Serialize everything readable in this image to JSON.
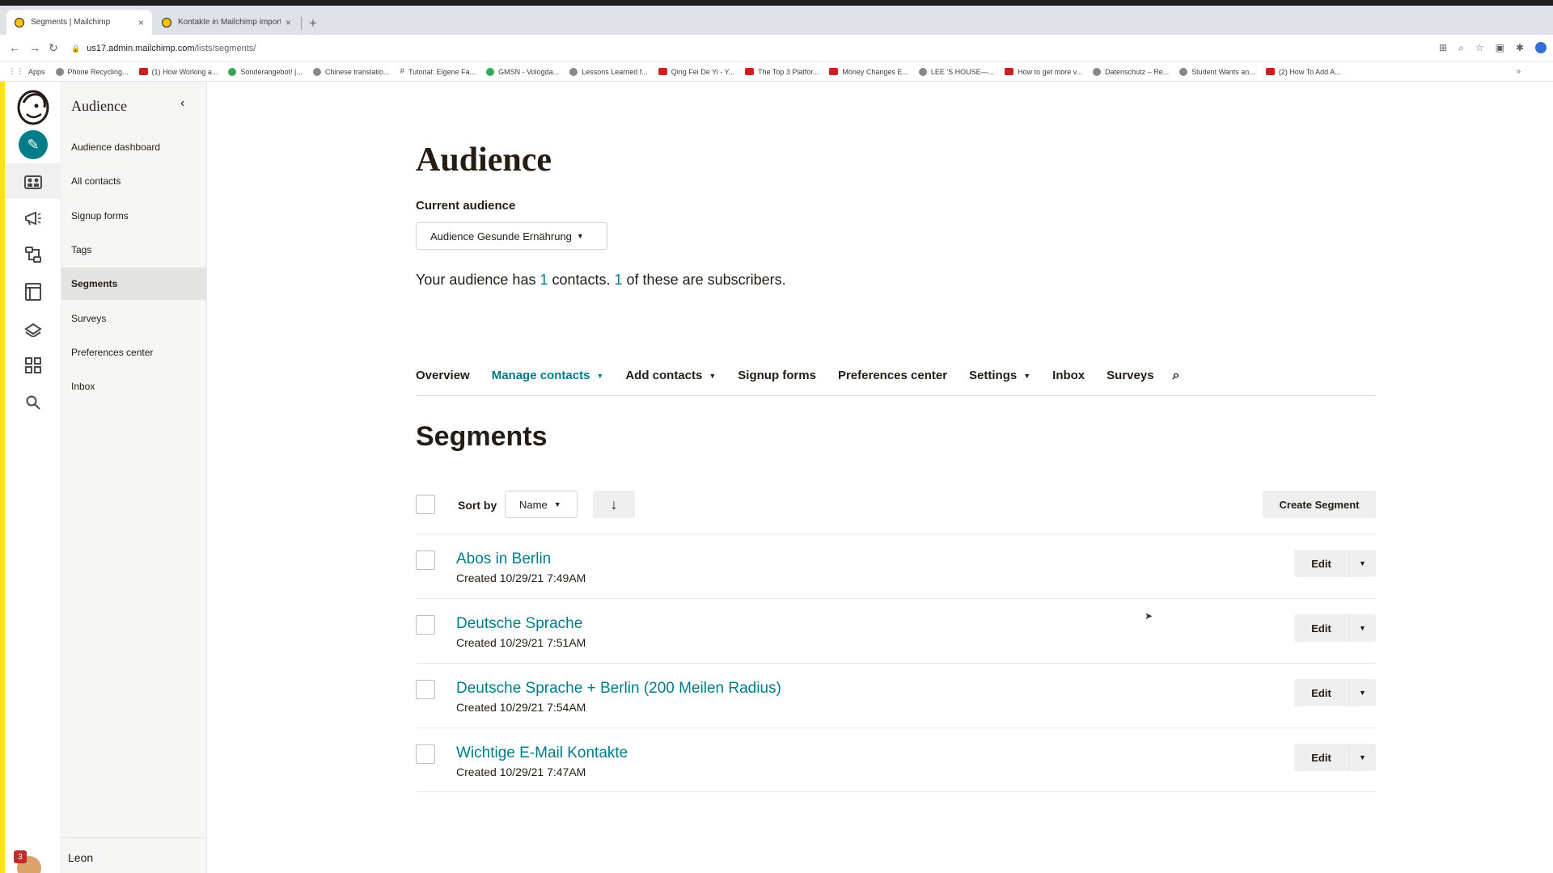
{
  "browser": {
    "tabs": [
      {
        "title": "Segments | Mailchimp",
        "active": true
      },
      {
        "title": "Kontakte in Mailchimp importi",
        "active": false
      }
    ],
    "url_domain": "us17.admin.mailchimp.com",
    "url_path": "/lists/segments/",
    "bookmarks": [
      {
        "label": "Apps",
        "icon": "grid-icon"
      },
      {
        "label": "Phone Recycling...",
        "icon": "search-icon"
      },
      {
        "label": "(1) How Working a...",
        "icon": "youtube-icon"
      },
      {
        "label": "Sonderangebot! |...",
        "icon": "site-icon"
      },
      {
        "label": "Chinese translatio...",
        "icon": "site-icon"
      },
      {
        "label": "Tutorial: Eigene Fa...",
        "icon": "hash-icon"
      },
      {
        "label": "GMSN - Vologda...",
        "icon": "site-icon"
      },
      {
        "label": "Lessons Learned f...",
        "icon": "site-icon"
      },
      {
        "label": "Qing Fei De Yi - Y...",
        "icon": "youtube-icon"
      },
      {
        "label": "The Top 3 Platfor...",
        "icon": "youtube-icon"
      },
      {
        "label": "Money Changes E...",
        "icon": "youtube-icon"
      },
      {
        "label": "LEE 'S HOUSE—...",
        "icon": "site-icon"
      },
      {
        "label": "How to get more v...",
        "icon": "youtube-icon"
      },
      {
        "label": "Datenschutz – Re...",
        "icon": "site-icon"
      },
      {
        "label": "Student Wants an...",
        "icon": "site-icon"
      },
      {
        "label": "(2) How To Add A...",
        "icon": "youtube-icon"
      }
    ]
  },
  "subnav": {
    "title": "Audience",
    "items": [
      {
        "label": "Audience dashboard",
        "active": false
      },
      {
        "label": "All contacts",
        "active": false
      },
      {
        "label": "Signup forms",
        "active": false
      },
      {
        "label": "Tags",
        "active": false
      },
      {
        "label": "Segments",
        "active": true
      },
      {
        "label": "Surveys",
        "active": false
      },
      {
        "label": "Preferences center",
        "active": false
      },
      {
        "label": "Inbox",
        "active": false
      }
    ],
    "user_name": "Leon",
    "notification_count": "3"
  },
  "main": {
    "title": "Audience",
    "current_audience_label": "Current audience",
    "current_audience": "Audience Gesunde Ernährung",
    "summary": {
      "prefix": "Your audience has ",
      "contacts": "1",
      "middle": " contacts. ",
      "subscribers": "1",
      "suffix": " of these are subscribers."
    },
    "tabs": [
      {
        "label": "Overview",
        "dropdown": false,
        "active": false
      },
      {
        "label": "Manage contacts",
        "dropdown": true,
        "active": true
      },
      {
        "label": "Add contacts",
        "dropdown": true,
        "active": false
      },
      {
        "label": "Signup forms",
        "dropdown": false,
        "active": false
      },
      {
        "label": "Preferences center",
        "dropdown": false,
        "active": false
      },
      {
        "label": "Settings",
        "dropdown": true,
        "active": false
      },
      {
        "label": "Inbox",
        "dropdown": false,
        "active": false
      },
      {
        "label": "Surveys",
        "dropdown": false,
        "active": false
      }
    ],
    "section_title": "Segments",
    "sort_label": "Sort by",
    "sort_value": "Name",
    "create_segment_label": "Create Segment",
    "edit_label": "Edit",
    "segments": [
      {
        "name": "Abos in Berlin",
        "created": "Created 10/29/21 7:49AM"
      },
      {
        "name": "Deutsche Sprache",
        "created": "Created 10/29/21 7:51AM"
      },
      {
        "name": "Deutsche Sprache + Berlin (200 Meilen Radius)",
        "created": "Created 10/29/21 7:54AM"
      },
      {
        "name": "Wichtige E-Mail Kontakte",
        "created": "Created 10/29/21 7:47AM"
      }
    ]
  },
  "colors": {
    "brand_yellow": "#ffe01b",
    "accent_teal": "#007c89"
  }
}
